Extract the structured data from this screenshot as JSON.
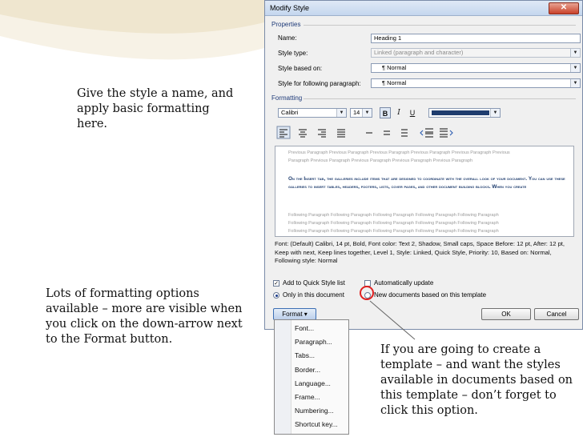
{
  "callouts": {
    "style_name": "Give the style a name, and apply basic formatting here.",
    "format_options": "Lots of formatting options available – more are visible when you click on the down-arrow next to the Format button.",
    "template_option": "If you are going to create a template – and want the styles available in documents based on this template – don’t forget to click this option."
  },
  "dialog": {
    "title": "Modify Style",
    "close_glyph": "✕",
    "properties_label": "Properties",
    "name_label": "Name:",
    "name_value": "Heading 1",
    "style_type_label": "Style type:",
    "style_type_value": "Linked (paragraph and character)",
    "based_on_label": "Style based on:",
    "based_on_value": "¶ Normal",
    "following_label": "Style for following paragraph:",
    "following_value": "¶ Normal",
    "formatting_label": "Formatting",
    "font_value": "Calibri",
    "size_value": "14",
    "bold": "B",
    "italic": "I",
    "underline": "U",
    "font_color": "#1f3d6e",
    "preview": {
      "previous": [
        "Previous Paragraph Previous Paragraph Previous Paragraph Previous Paragraph Previous Paragraph Previous",
        "Paragraph Previous Paragraph Previous Paragraph Previous Paragraph Previous Paragraph"
      ],
      "main": "On the Insert tab, the galleries include items that are designed to coordinate with the overall look of your document. You can use these galleries to insert tables, headers, footers, lists, cover pages, and other document building blocks. When you create",
      "following": [
        "Following Paragraph Following Paragraph Following Paragraph Following Paragraph Following Paragraph",
        "Following Paragraph Following Paragraph Following Paragraph Following Paragraph Following Paragraph",
        "Following Paragraph Following Paragraph Following Paragraph Following Paragraph Following Paragraph"
      ]
    },
    "description": "Font: (Default) Calibri, 14 pt, Bold, Font color: Text 2, Shadow, Small caps, Space Before:  12 pt, After:  12 pt, Keep with next, Keep lines together, Level 1, Style: Linked, Quick Style, Priority: 10, Based on: Normal, Following style: Normal",
    "add_quick_style": "Add to Quick Style list",
    "auto_update": "Automatically update",
    "only_this_doc": "Only in this document",
    "new_docs": "New documents based on this template",
    "format_button": "Format ▾",
    "ok_button": "OK",
    "cancel_button": "Cancel"
  },
  "format_menu": {
    "items": [
      "Font...",
      "Paragraph...",
      "Tabs...",
      "Border...",
      "Language...",
      "Frame...",
      "Numbering...",
      "Shortcut key..."
    ]
  }
}
